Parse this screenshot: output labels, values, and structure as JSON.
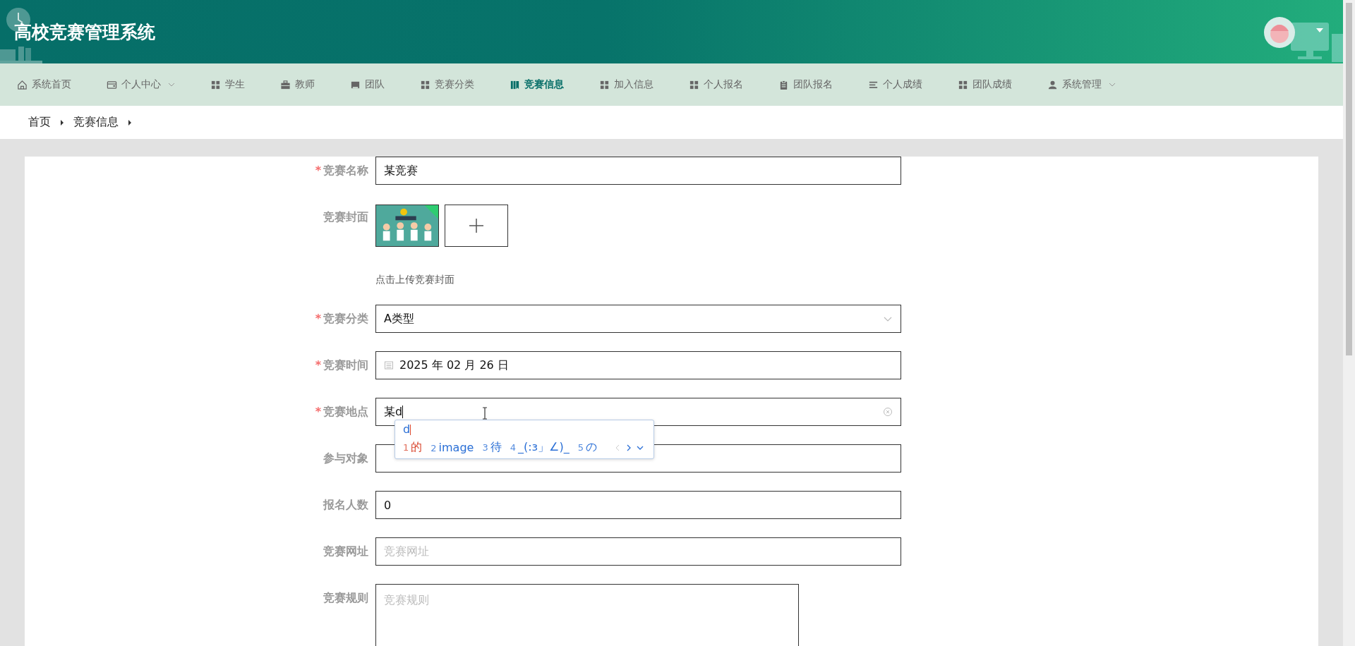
{
  "header": {
    "title": "高校竞赛管理系统"
  },
  "nav": [
    {
      "label": "系统首页",
      "selected": false
    },
    {
      "label": "个人中心",
      "dropdown": true,
      "selected": false
    },
    {
      "label": "学生",
      "selected": false
    },
    {
      "label": "教师",
      "selected": false
    },
    {
      "label": "团队",
      "selected": false
    },
    {
      "label": "竞赛分类",
      "selected": false
    },
    {
      "label": "竞赛信息",
      "selected": true
    },
    {
      "label": "加入信息",
      "selected": false
    },
    {
      "label": "个人报名",
      "selected": false
    },
    {
      "label": "团队报名",
      "selected": false
    },
    {
      "label": "个人成绩",
      "selected": false
    },
    {
      "label": "团队成绩",
      "selected": false
    },
    {
      "label": "系统管理",
      "dropdown": true,
      "selected": false
    }
  ],
  "breadcrumb": [
    "首页",
    "竞赛信息"
  ],
  "form": [
    {
      "label": "竞赛名称",
      "required_mark": "*",
      "kind": "text",
      "value": "某竞赛"
    },
    {
      "label": "竞赛封面",
      "kind": "upload",
      "hint": "点击上传竞赛封面"
    },
    {
      "label": "竞赛分类",
      "required_mark": "*",
      "kind": "select",
      "value": "A类型"
    },
    {
      "label": "竞赛时间",
      "required_mark": "*",
      "kind": "date",
      "value": "2025 年 02 月 26 日"
    },
    {
      "label": "竞赛地点",
      "required_mark": "*",
      "kind": "text",
      "value": "某d",
      "clearable": true
    },
    {
      "label": "参与对象",
      "kind": "text"
    },
    {
      "label": "报名人数",
      "kind": "text",
      "value": "0"
    },
    {
      "label": "竞赛网址",
      "kind": "text",
      "placeholder": "竞赛网址"
    },
    {
      "label": "竞赛规则",
      "kind": "textarea",
      "placeholder": "竞赛规则"
    }
  ],
  "ime": {
    "composition": "d",
    "candidates": [
      {
        "index": "1",
        "text": "的",
        "selected": true
      },
      {
        "index": "2",
        "text": "image",
        "selected": false
      },
      {
        "index": "3",
        "text": "待",
        "selected": false
      },
      {
        "index": "4",
        "text": "_(:з」∠)_",
        "selected": false
      },
      {
        "index": "5",
        "text": "の",
        "selected": false
      }
    ]
  }
}
